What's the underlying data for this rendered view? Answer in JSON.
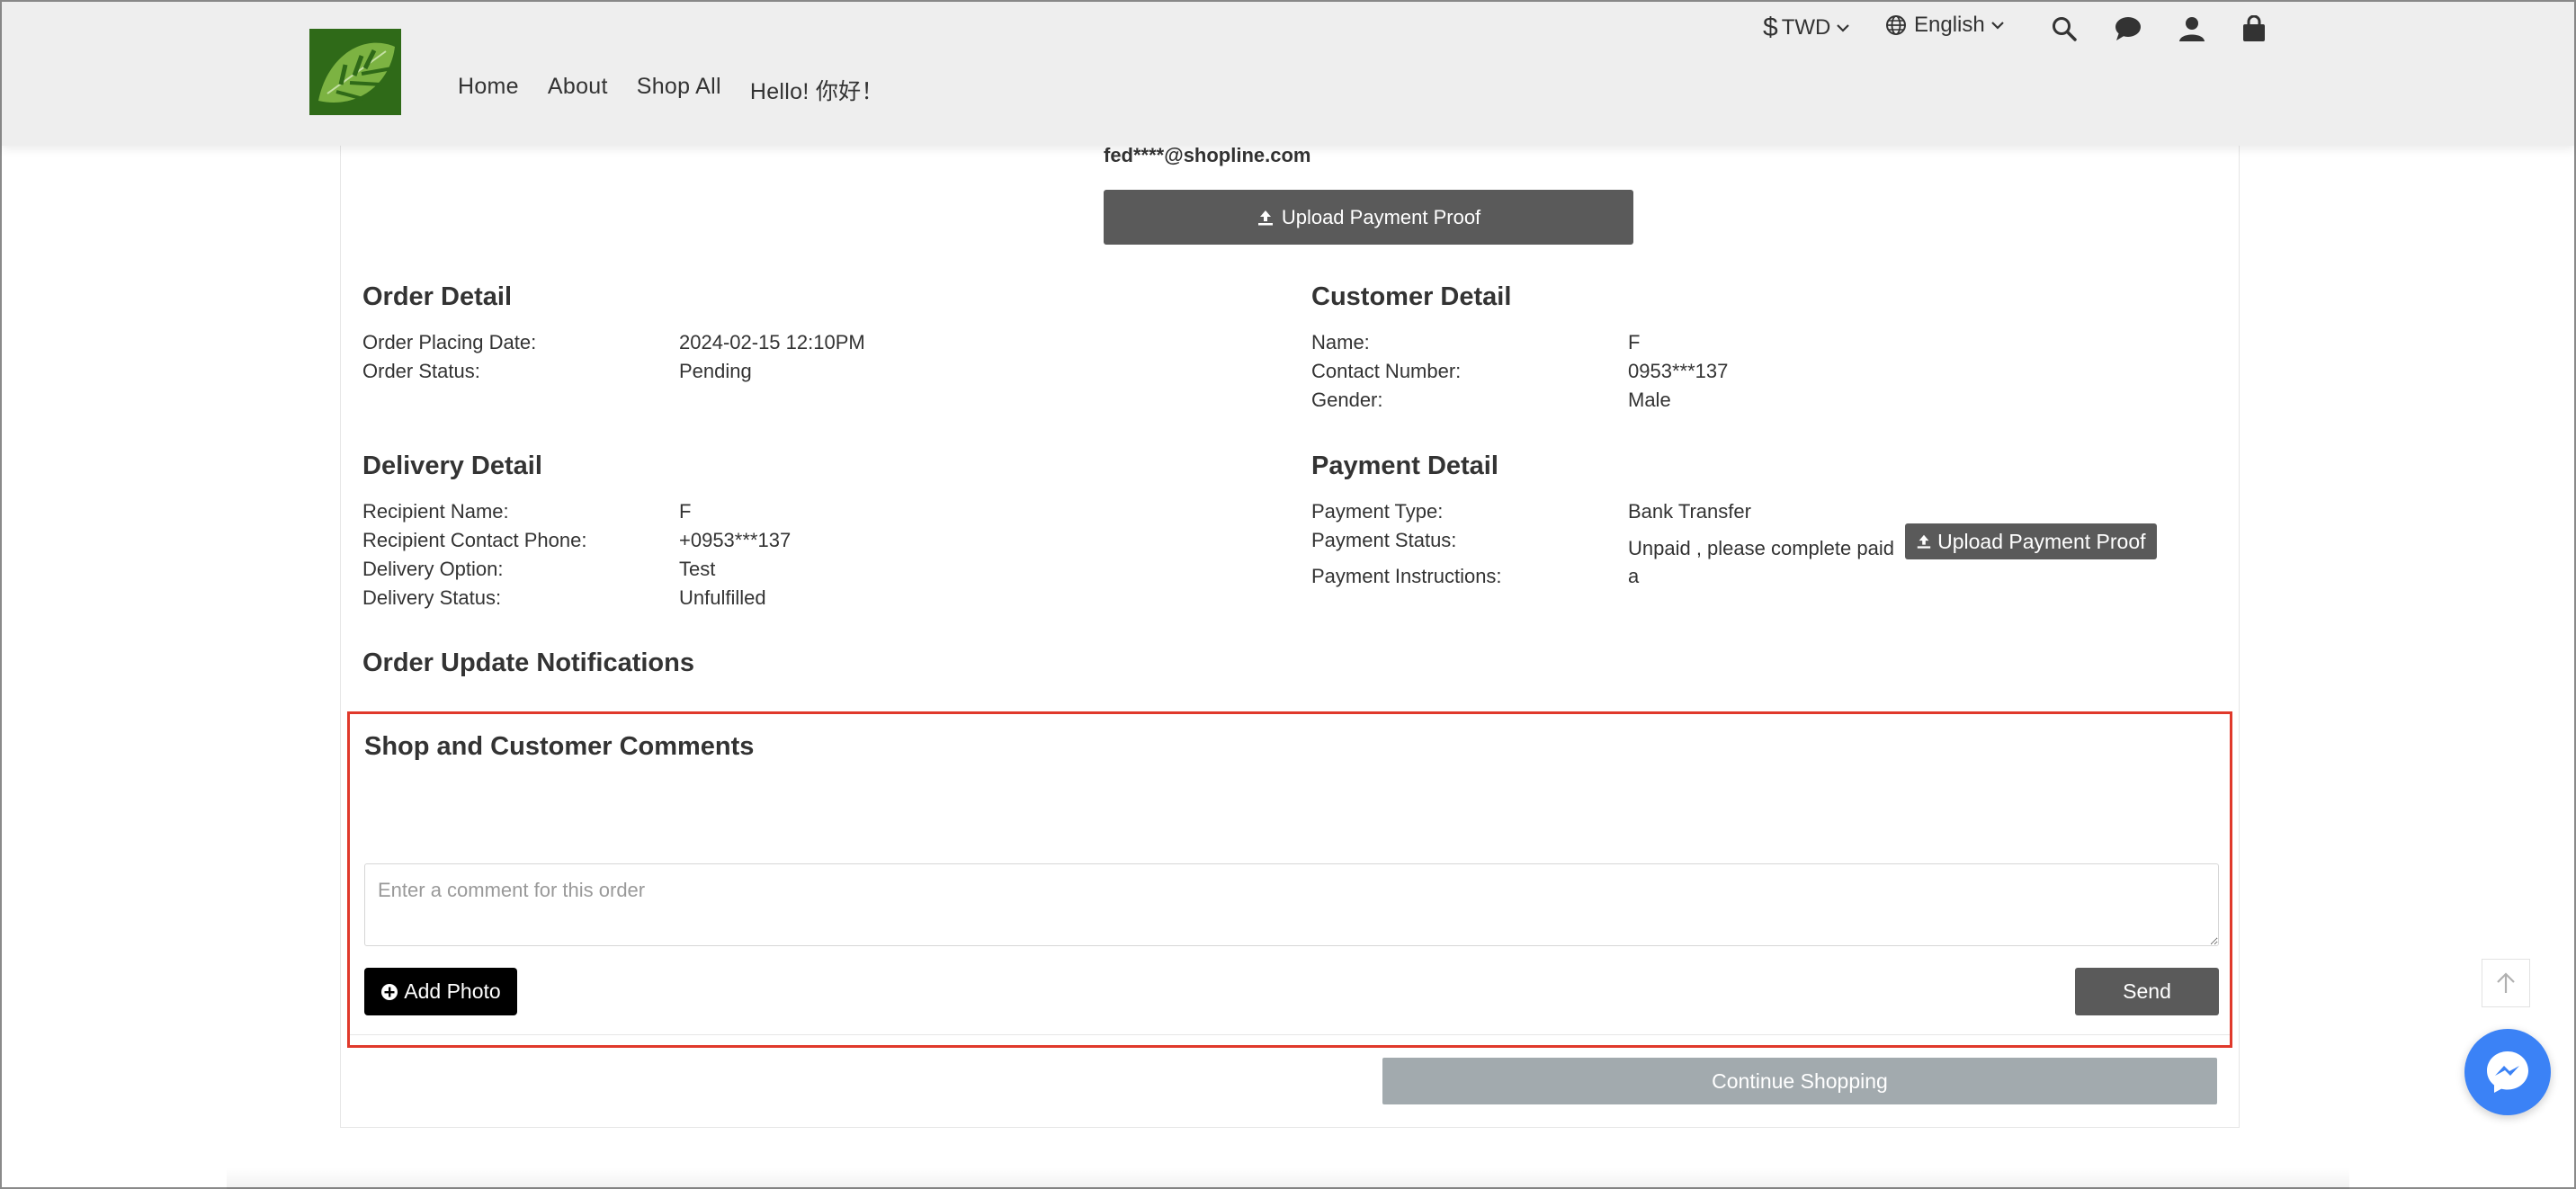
{
  "header": {
    "nav": [
      "Home",
      "About",
      "Shop All",
      "Hello! 你好！"
    ],
    "currency_symbol": "$",
    "currency": "TWD",
    "language": "English"
  },
  "payment_proof": {
    "email": "fed****@shopline.com",
    "upload_label": "Upload Payment Proof"
  },
  "order_detail": {
    "title": "Order Detail",
    "rows": [
      {
        "label": "Order Placing Date:",
        "value": "2024-02-15 12:10PM"
      },
      {
        "label": "Order Status:",
        "value": "Pending"
      }
    ]
  },
  "customer_detail": {
    "title": "Customer Detail",
    "rows": [
      {
        "label": "Name:",
        "value": "F"
      },
      {
        "label": "Contact Number:",
        "value": "0953***137"
      },
      {
        "label": "Gender:",
        "value": "Male"
      }
    ]
  },
  "delivery_detail": {
    "title": "Delivery Detail",
    "rows": [
      {
        "label": "Recipient Name:",
        "value": "F"
      },
      {
        "label": "Recipient Contact Phone:",
        "value": "+0953***137"
      },
      {
        "label": "Delivery Option:",
        "value": "Test"
      },
      {
        "label": "Delivery Status:",
        "value": "Unfulfilled"
      }
    ]
  },
  "payment_detail": {
    "title": "Payment Detail",
    "rows": [
      {
        "label": "Payment Type:",
        "value": "Bank Transfer"
      },
      {
        "label": "Payment Status:",
        "value": "Unpaid , please complete paid"
      },
      {
        "label": "Payment Instructions:",
        "value": "a"
      }
    ],
    "upload_label": "Upload Payment Proof"
  },
  "notifications": {
    "title": "Order Update Notifications"
  },
  "comments": {
    "title": "Shop and Customer Comments",
    "placeholder": "Enter a comment for this order",
    "add_photo": "Add Photo",
    "send": "Send"
  },
  "continue_label": "Continue Shopping",
  "colors": {
    "highlight": "#e0392b",
    "dark_button": "#5a5a5a",
    "continue_button": "#a2aaae",
    "messenger": "#3b82f6"
  }
}
